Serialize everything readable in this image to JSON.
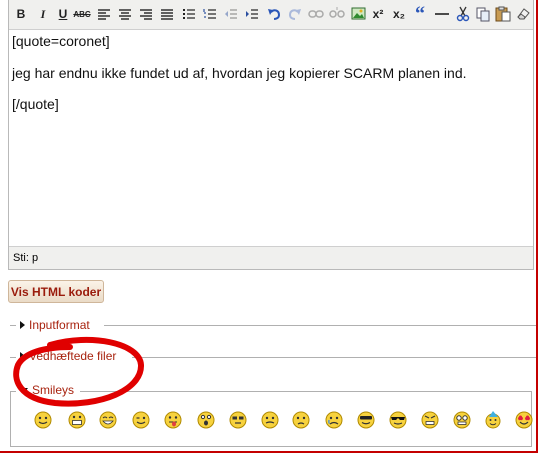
{
  "editor": {
    "toolbar": {
      "bold": "B",
      "italic": "I",
      "underline": "U",
      "strike": "ABC",
      "superscript": "x²",
      "subscript": "x₂",
      "quote": "“"
    },
    "content": {
      "line1": "[quote=coronet]",
      "line2": "jeg har endnu ikke fundet ud af, hvordan jeg kopierer SCARM planen ind.",
      "line3": "[/quote]"
    },
    "status": "Sti: p"
  },
  "html_button": "Vis HTML koder",
  "sections": {
    "inputformat": "Inputformat",
    "attachments": "Vedhæftede filer",
    "smileys": "Smileys"
  },
  "colors": {
    "annotation": "#e00000",
    "legend_text": "#a8230f"
  }
}
